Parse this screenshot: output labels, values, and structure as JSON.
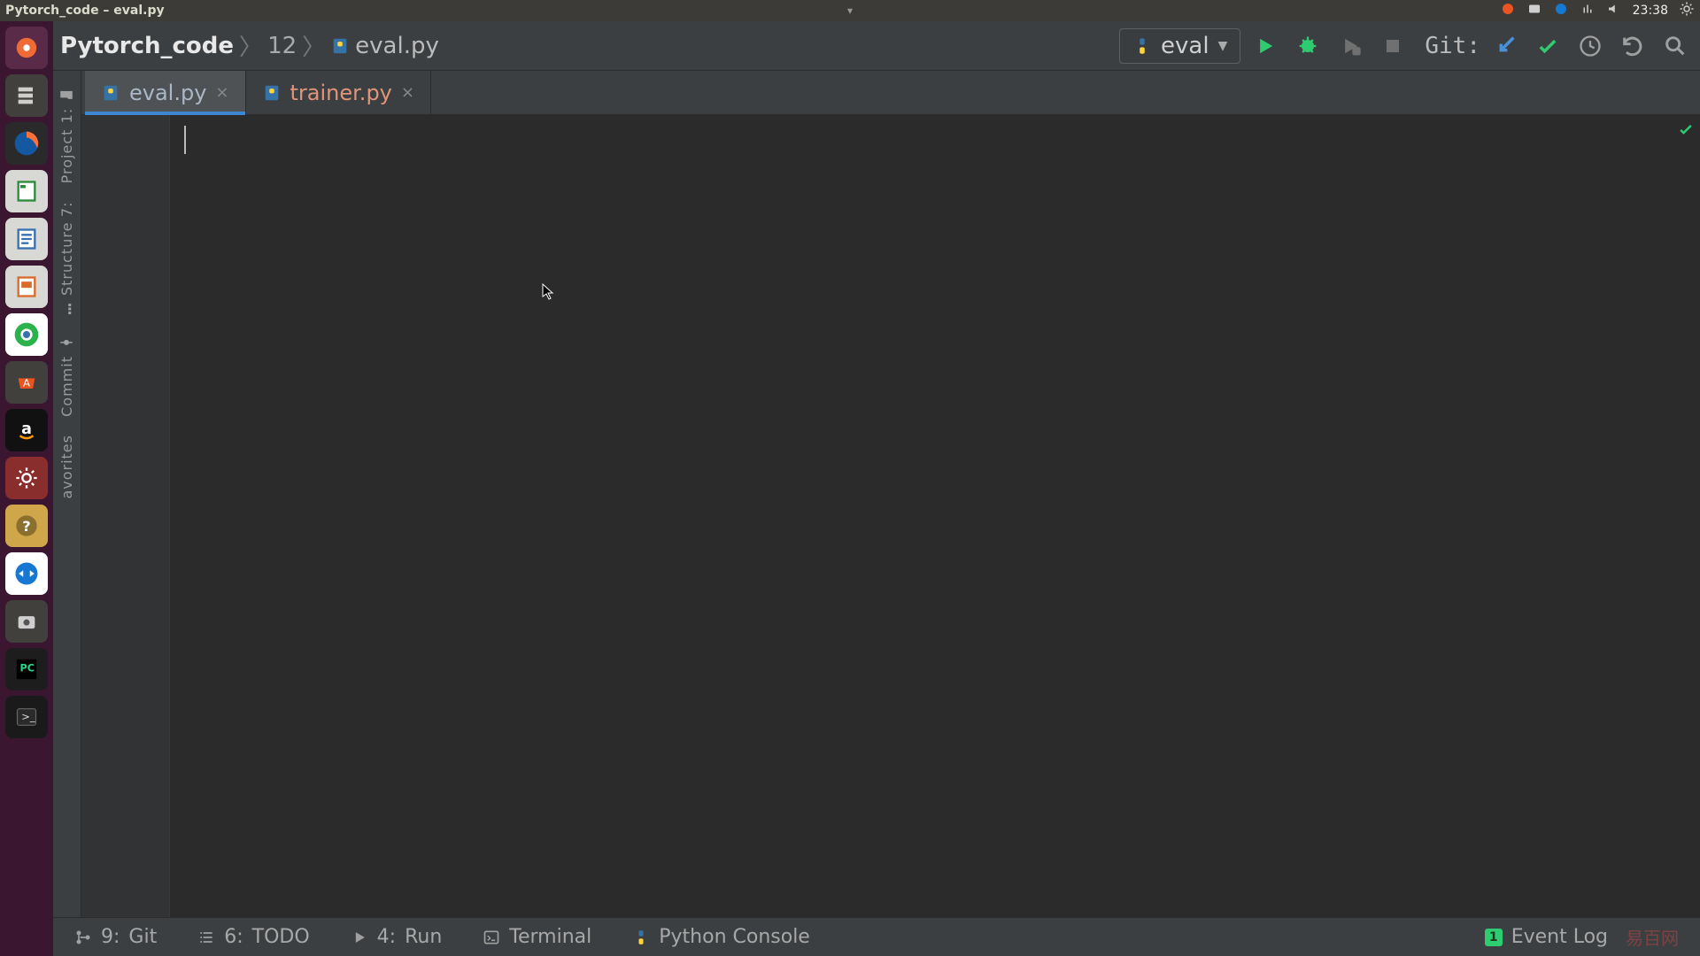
{
  "window": {
    "title": "Pytorch_code – eval.py"
  },
  "systray": {
    "time": "23:38"
  },
  "launcher": {
    "items": [
      {
        "name": "dash-icon",
        "color": "#e95420"
      },
      {
        "name": "files-icon",
        "color": "#e6e6e6"
      },
      {
        "name": "firefox-icon",
        "color": "#ff7139"
      },
      {
        "name": "calc-icon",
        "color": "#2e8b3d"
      },
      {
        "name": "writer-icon",
        "color": "#3a6fb0"
      },
      {
        "name": "impress-icon",
        "color": "#d96c2c"
      },
      {
        "name": "chrome-icon",
        "color": "#2bb24c"
      },
      {
        "name": "software-icon",
        "color": "#e95420"
      },
      {
        "name": "amazon-icon",
        "color": "#111111"
      },
      {
        "name": "settings-icon",
        "color": "#8a2d2d"
      },
      {
        "name": "help-icon",
        "color": "#cfa64a"
      },
      {
        "name": "teamviewer-icon",
        "color": "#1778d1"
      },
      {
        "name": "screenshot-icon",
        "color": "#555555"
      },
      {
        "name": "pycharm-icon",
        "color": "#1d1d1d"
      },
      {
        "name": "terminal-icon",
        "color": "#1a1a1a"
      }
    ]
  },
  "breadcrumb": {
    "project": "Pytorch_code",
    "folder": "12",
    "file": "eval.py"
  },
  "runcfg": {
    "label": "eval"
  },
  "git": {
    "label": "Git:"
  },
  "tabs": [
    {
      "name": "eval.py",
      "active": true,
      "modified": false
    },
    {
      "name": "trainer.py",
      "active": false,
      "modified": true
    }
  ],
  "side_tabs": {
    "project": "Project",
    "one": "1:",
    "structure": "Structure",
    "seven": "7:",
    "commit": "Commit",
    "favorites": "avorites"
  },
  "bottom": {
    "git": {
      "num": "9:",
      "label": "Git"
    },
    "todo": {
      "num": "6:",
      "label": "TODO"
    },
    "run": {
      "num": "4:",
      "label": "Run"
    },
    "terminal": "Terminal",
    "pyconsole": "Python Console",
    "eventlog": {
      "count": "1",
      "label": "Event Log"
    },
    "watermark": "易百网"
  }
}
